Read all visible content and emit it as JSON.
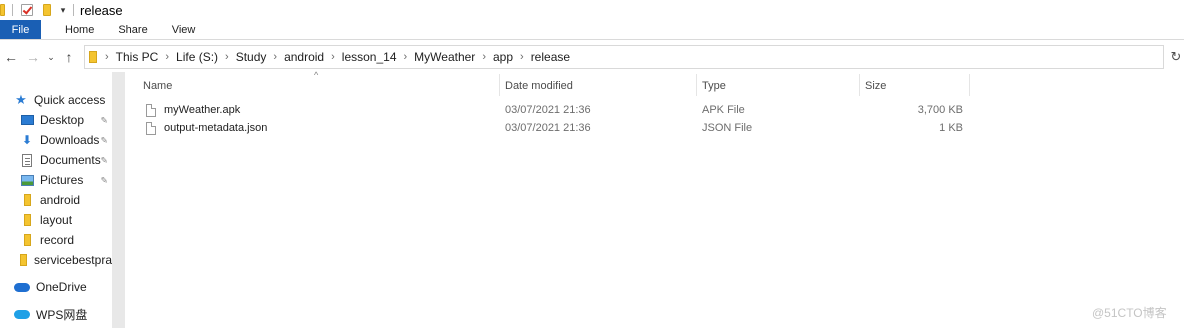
{
  "window": {
    "title": "release"
  },
  "ribbon": {
    "tabs": [
      "File",
      "Home",
      "Share",
      "View"
    ]
  },
  "nav": {
    "back": "←",
    "forward": "→",
    "recent": "⌄",
    "up": "↑",
    "refresh": "↻"
  },
  "breadcrumb": [
    "This PC",
    "Life (S:)",
    "Study",
    "android",
    "lesson_14",
    "MyWeather",
    "app",
    "release"
  ],
  "sidebar": {
    "items": [
      {
        "label": "Quick access",
        "icon": "star-icon",
        "pinned": false
      },
      {
        "label": "Desktop",
        "icon": "desktop-icon",
        "pinned": true
      },
      {
        "label": "Downloads",
        "icon": "downloads-icon",
        "pinned": true
      },
      {
        "label": "Documents",
        "icon": "documents-icon",
        "pinned": true
      },
      {
        "label": "Pictures",
        "icon": "pictures-icon",
        "pinned": true
      },
      {
        "label": "android",
        "icon": "folder-icon",
        "pinned": false
      },
      {
        "label": "layout",
        "icon": "folder-icon",
        "pinned": false
      },
      {
        "label": "record",
        "icon": "folder-icon",
        "pinned": false
      },
      {
        "label": "servicebestpra",
        "icon": "folder-icon",
        "pinned": false
      },
      {
        "label": "OneDrive",
        "icon": "onedrive-icon",
        "pinned": false
      },
      {
        "label": "WPS网盘",
        "icon": "wps-cloud-icon",
        "pinned": false
      }
    ]
  },
  "columns": {
    "name": "Name",
    "date": "Date modified",
    "type": "Type",
    "size": "Size"
  },
  "files": [
    {
      "name": "myWeather.apk",
      "date": "03/07/2021 21:36",
      "type": "APK File",
      "size": "3,700 KB"
    },
    {
      "name": "output-metadata.json",
      "date": "03/07/2021 21:36",
      "type": "JSON File",
      "size": "1 KB"
    }
  ],
  "watermark": "@51CTO博客",
  "colors": {
    "file_tab": "#1a5fb4",
    "accent": "#2b7cd3",
    "folder": "#f4c430"
  }
}
